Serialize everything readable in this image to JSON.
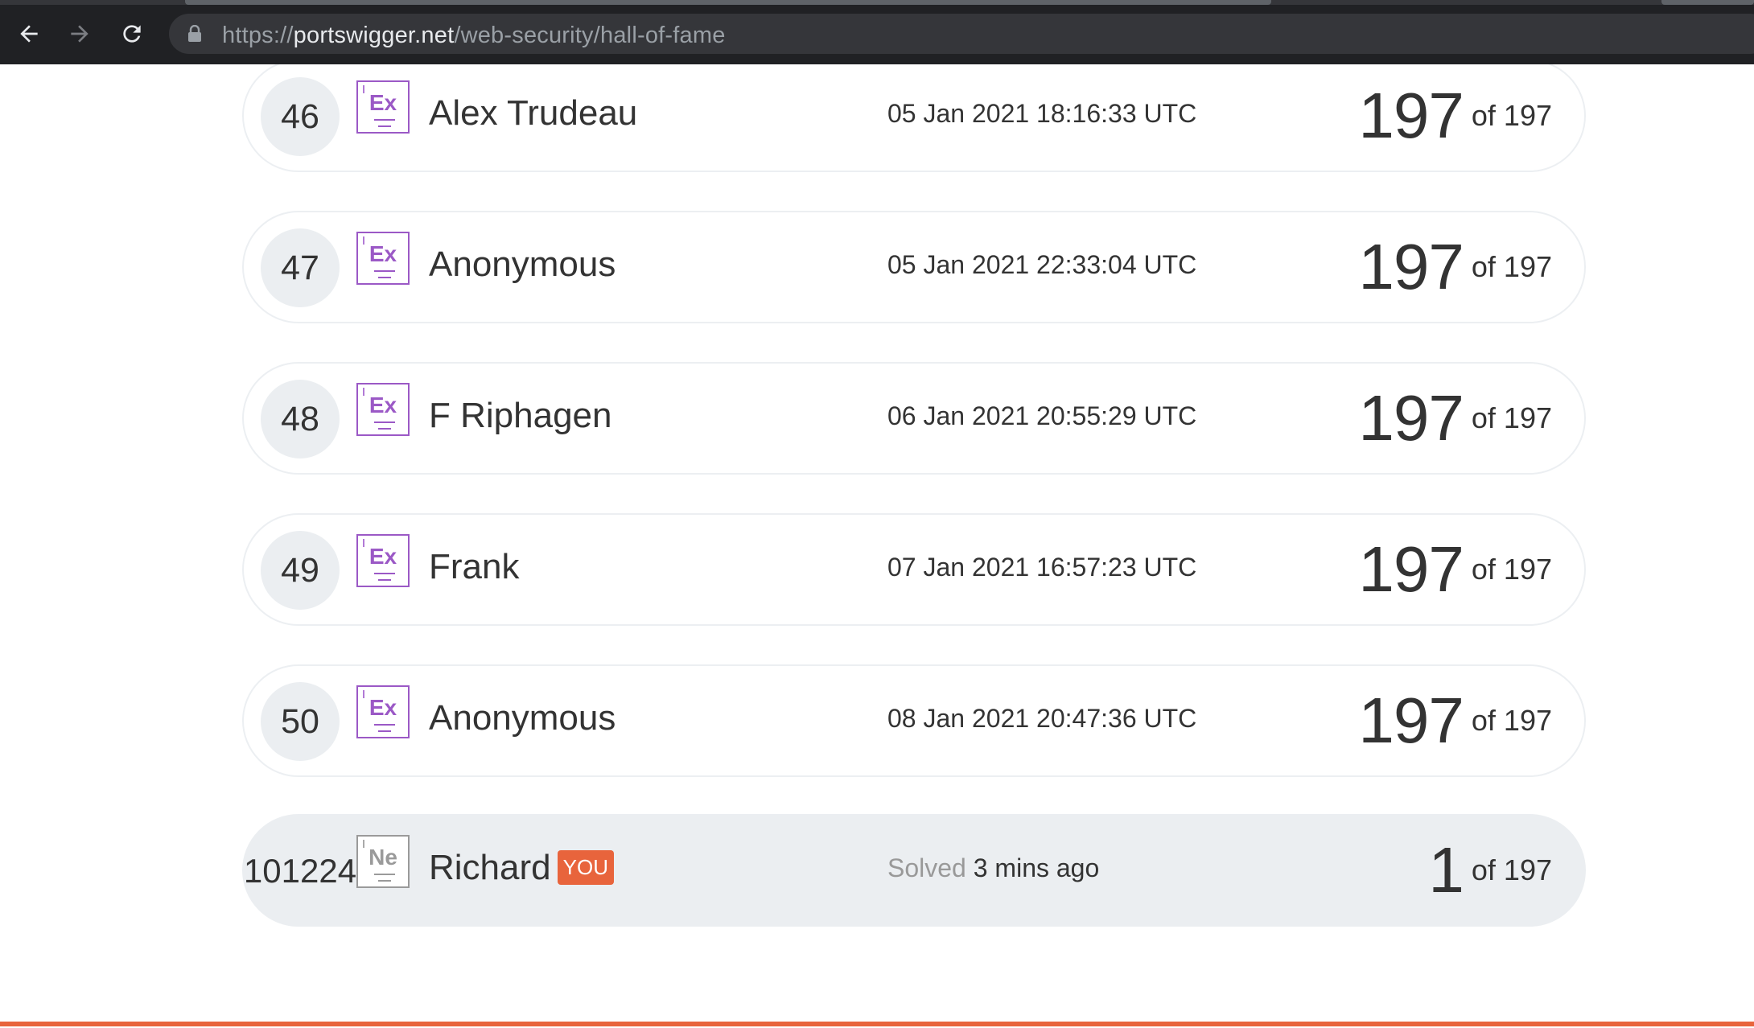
{
  "browser": {
    "url_scheme": "https://",
    "url_host": "portswigger.net",
    "url_path": "/web-security/hall-of-fame"
  },
  "rows": [
    {
      "rank": "46",
      "badge": "Ex",
      "name": "Alex Trudeau",
      "date": "05 Jan 2021 18:16:33 UTC",
      "score": "197",
      "of": "of 197"
    },
    {
      "rank": "47",
      "badge": "Ex",
      "name": "Anonymous",
      "date": "05 Jan 2021 22:33:04 UTC",
      "score": "197",
      "of": "of 197"
    },
    {
      "rank": "48",
      "badge": "Ex",
      "name": "F Riphagen",
      "date": "06 Jan 2021 20:55:29 UTC",
      "score": "197",
      "of": "of 197"
    },
    {
      "rank": "49",
      "badge": "Ex",
      "name": "Frank",
      "date": "07 Jan 2021 16:57:23 UTC",
      "score": "197",
      "of": "of 197"
    },
    {
      "rank": "50",
      "badge": "Ex",
      "name": "Anonymous",
      "date": "08 Jan 2021 20:47:36 UTC",
      "score": "197",
      "of": "of 197"
    }
  ],
  "current_user": {
    "rank": "101224",
    "badge": "Ne",
    "name": "Richard",
    "you_tag": "YOU",
    "solved_label": "Solved",
    "solved_time": "3 mins ago",
    "score": "1",
    "of": "of 197"
  },
  "colors": {
    "accent": "#e8643c",
    "expert_badge": "#9b59c6",
    "novice_badge": "#9a9a9a",
    "row_border": "#eceff2",
    "highlight_row": "#ebeef1"
  },
  "icons": {
    "back": "arrow-left-icon",
    "forward": "arrow-right-icon",
    "reload": "reload-icon",
    "lock": "lock-icon"
  }
}
